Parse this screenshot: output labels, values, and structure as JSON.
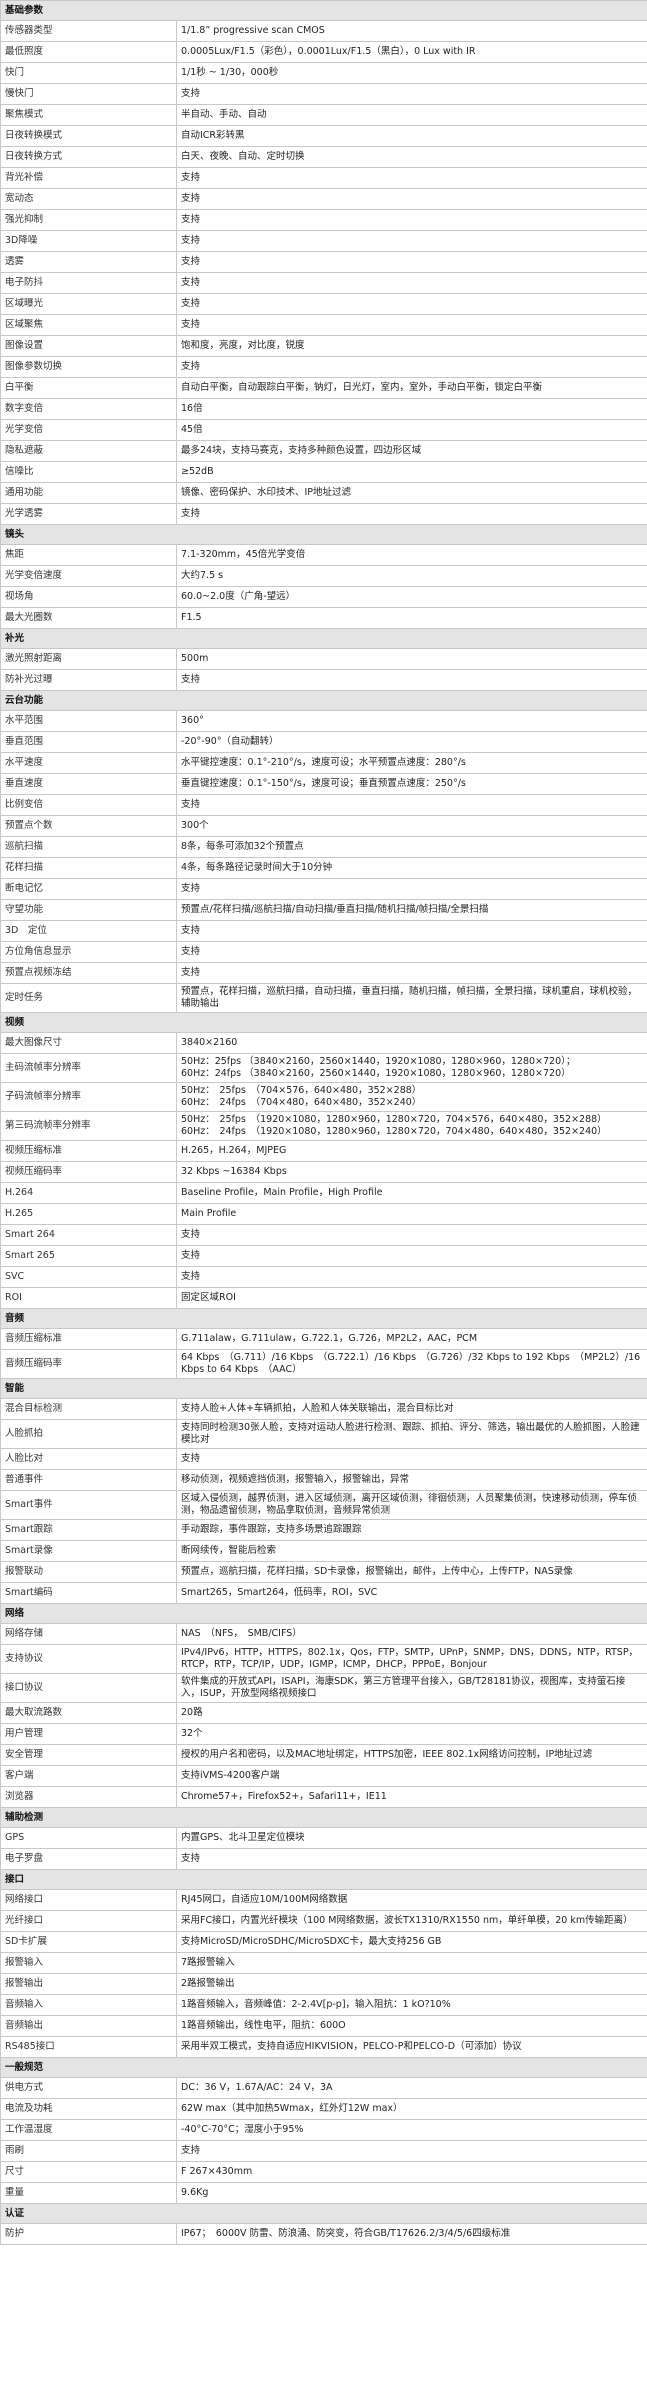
{
  "sections": [
    {
      "title": "基础参数",
      "rows": [
        [
          "传感器类型",
          "1/1.8” progressive scan CMOS"
        ],
        [
          "最低照度",
          "0.0005Lux/F1.5（彩色），0.0001Lux/F1.5（黑白），0 Lux with IR"
        ],
        [
          "快门",
          "1/1秒 ~ 1/30，000秒"
        ],
        [
          "慢快门",
          "支持"
        ],
        [
          "聚焦模式",
          "半自动、手动、自动"
        ],
        [
          "日夜转换模式",
          "自动ICR彩转黑"
        ],
        [
          "日夜转换方式",
          "白天、夜晚、自动、定时切换"
        ],
        [
          "背光补偿",
          "支持"
        ],
        [
          "宽动态",
          "支持"
        ],
        [
          "强光抑制",
          "支持"
        ],
        [
          "3D降噪",
          "支持"
        ],
        [
          "透雾",
          "支持"
        ],
        [
          "电子防抖",
          "支持"
        ],
        [
          "区域曝光",
          "支持"
        ],
        [
          "区域聚焦",
          "支持"
        ],
        [
          "图像设置",
          "饱和度，亮度，对比度，锐度"
        ],
        [
          "图像参数切换",
          "支持"
        ],
        [
          "白平衡",
          "自动白平衡，自动跟踪白平衡，钠灯，日光灯，室内，室外，手动白平衡，锁定白平衡"
        ],
        [
          "数字变倍",
          "16倍"
        ],
        [
          "光学变倍",
          "45倍"
        ],
        [
          "隐私遮蔽",
          "最多24块，支持马赛克，支持多种颜色设置，四边形区域"
        ],
        [
          "信噪比",
          "≥52dB"
        ],
        [
          "通用功能",
          "镜像、密码保护、水印技术、IP地址过滤"
        ],
        [
          "光学透雾",
          "支持"
        ]
      ]
    },
    {
      "title": "镜头",
      "rows": [
        [
          "焦距",
          "7.1-320mm，45倍光学变倍"
        ],
        [
          "光学变倍速度",
          "大约7.5 s"
        ],
        [
          "视场角",
          "60.0~2.0度（广角-望远）"
        ],
        [
          "最大光圈数",
          "F1.5"
        ]
      ]
    },
    {
      "title": "补光",
      "rows": [
        [
          "激光照射距离",
          "500m"
        ],
        [
          "防补光过曝",
          "支持"
        ]
      ]
    },
    {
      "title": "云台功能",
      "rows": [
        [
          "水平范围",
          "360°"
        ],
        [
          "垂直范围",
          "-20°-90°（自动翻转）"
        ],
        [
          "水平速度",
          "水平键控速度：0.1°-210°/s，速度可设；水平预置点速度：280°/s"
        ],
        [
          "垂直速度",
          "垂直键控速度：0.1°-150°/s，速度可设；垂直预置点速度：250°/s"
        ],
        [
          "比例变倍",
          "支持"
        ],
        [
          "预置点个数",
          "300个"
        ],
        [
          "巡航扫描",
          "8条，每条可添加32个预置点"
        ],
        [
          "花样扫描",
          "4条，每条路径记录时间大于10分钟"
        ],
        [
          "断电记忆",
          "支持"
        ],
        [
          "守望功能",
          "预置点/花样扫描/巡航扫描/自动扫描/垂直扫描/随机扫描/帧扫描/全景扫描"
        ],
        [
          "3D　定位",
          "支持"
        ],
        [
          "方位角信息显示",
          "支持"
        ],
        [
          "预置点视频冻结",
          "支持"
        ],
        [
          "定时任务",
          "预置点，花样扫描，巡航扫描，自动扫描，垂直扫描，随机扫描，帧扫描，全景扫描，球机重启，球机校验，辅助输出"
        ]
      ]
    },
    {
      "title": "视频",
      "rows": [
        [
          "最大图像尺寸",
          "3840×2160"
        ],
        [
          "主码流帧率分辨率",
          "50Hz：25fps （3840×2160，2560×1440，1920×1080，1280×960，1280×720）；\n60Hz：24fps （3840×2160，2560×1440，1920×1080，1280×960，1280×720）"
        ],
        [
          "子码流帧率分辨率",
          "50Hz：　25fps　（704×576，640×480，352×288）\n60Hz：　24fps　（704×480，640×480，352×240）"
        ],
        [
          "第三码流帧率分辨率",
          "50Hz：　25fps　（1920×1080，1280×960，1280×720，704×576，640×480，352×288）\n60Hz：　24fps　（1920×1080，1280×960，1280×720，704×480，640×480，352×240）"
        ],
        [
          "视频压缩标准",
          "H.265，H.264，MJPEG"
        ],
        [
          "视频压缩码率",
          "32 Kbps ~16384 Kbps"
        ],
        [
          "H.264",
          "Baseline Profile，Main Profile，High Profile"
        ],
        [
          "H.265",
          "Main Profile"
        ],
        [
          "Smart 264",
          "支持"
        ],
        [
          "Smart 265",
          "支持"
        ],
        [
          "SVC",
          "支持"
        ],
        [
          "ROI",
          "固定区域ROI"
        ]
      ]
    },
    {
      "title": "音频",
      "rows": [
        [
          "音频压缩标准",
          "G.711alaw，G.711ulaw，G.722.1，G.726，MP2L2，AAC，PCM"
        ],
        [
          "音频压缩码率",
          "64 Kbps　（G.711）/16 Kbps　（G.722.1）/16 Kbps　（G.726）/32 Kbps to 192 Kbps　（MP2L2）/16 Kbps to 64 Kbps　（AAC）"
        ]
      ]
    },
    {
      "title": "智能",
      "rows": [
        [
          "混合目标检测",
          "支持人脸+人体+车辆抓拍，人脸和人体关联输出，混合目标比对"
        ],
        [
          "人脸抓拍",
          "支持同时检测30张人脸，支持对运动人脸进行检测、跟踪、抓拍、评分、筛选，输出最优的人脸抓图，人脸建模比对"
        ],
        [
          "人脸比对",
          "支持"
        ],
        [
          "普通事件",
          "移动侦测，视频遮挡侦测，报警输入，报警输出，异常"
        ],
        [
          "Smart事件",
          "区域入侵侦测，越界侦测，进入区域侦测，离开区域侦测，徘徊侦测，人员聚集侦测，快速移动侦测，停车侦测，物品遗留侦测，物品拿取侦测，音频异常侦测"
        ],
        [
          "Smart跟踪",
          "手动跟踪，事件跟踪，支持多场景追踪跟踪"
        ],
        [
          "Smart录像",
          "断网续传，智能后检索"
        ],
        [
          "报警联动",
          "预置点，巡航扫描，花样扫描，SD卡录像，报警输出，邮件，上传中心，上传FTP，NAS录像"
        ],
        [
          "Smart编码",
          "Smart265，Smart264，低码率，ROI，SVC"
        ]
      ]
    },
    {
      "title": "网络",
      "rows": [
        [
          "网络存储",
          "NAS　（NFS，　SMB/CIFS）"
        ],
        [
          "支持协议",
          "IPv4/IPv6，HTTP，HTTPS，802.1x，Qos，FTP，SMTP，UPnP，SNMP，DNS，DDNS，NTP，RTSP，RTCP，RTP，TCP/IP，UDP，IGMP，ICMP，DHCP，PPPoE，Bonjour"
        ],
        [
          "接口协议",
          "软件集成的开放式API，ISAPI，海康SDK，第三方管理平台接入，GB/T28181协议，视图库，支持萤石接入，ISUP，开放型网络视频接口"
        ],
        [
          "最大取流路数",
          "20路"
        ],
        [
          "用户管理",
          "32个"
        ],
        [
          "安全管理",
          "授权的用户名和密码，以及MAC地址绑定，HTTPS加密，IEEE 802.1x网络访问控制，IP地址过滤"
        ],
        [
          "客户端",
          "支持iVMS-4200客户端"
        ],
        [
          "浏览器",
          "Chrome57+，Firefox52+，Safari11+，IE11"
        ]
      ]
    },
    {
      "title": "辅助检测",
      "rows": [
        [
          "GPS",
          "内置GPS、北斗卫星定位模块"
        ],
        [
          "电子罗盘",
          "支持"
        ]
      ]
    },
    {
      "title": "接口",
      "rows": [
        [
          "网络接口",
          "RJ45网口，自适应10M/100M网络数据"
        ],
        [
          "光纤接口",
          "采用FC接口，内置光纤模块（100 M网络数据，波长TX1310/RX1550 nm，单纤单模，20 km传输距离）"
        ],
        [
          "SD卡扩展",
          "支持MicroSD/MicroSDHC/MicroSDXC卡，最大支持256 GB"
        ],
        [
          "报警输入",
          "7路报警输入"
        ],
        [
          "报警输出",
          "2路报警输出"
        ],
        [
          "音频输入",
          "1路音频输入，音频峰值：2-2.4V[p-p]，输入阻抗：1 kO?10%"
        ],
        [
          "音频输出",
          "1路音频输出，线性电平，阻抗：600O"
        ],
        [
          "RS485接口",
          "采用半双工模式，支持自适应HIKVISION，PELCO-P和PELCO-D（可添加）协议"
        ]
      ]
    },
    {
      "title": "一般规范",
      "rows": [
        [
          "供电方式",
          "DC：36 V，1.67A/AC：24 V，3A"
        ],
        [
          "电流及功耗",
          "62W max（其中加热5Wmax，红外灯12W max）"
        ],
        [
          "工作温湿度",
          "-40°C-70°C；湿度小于95%"
        ],
        [
          "雨刷",
          "支持"
        ],
        [
          "尺寸",
          "F 267×430mm"
        ],
        [
          "重量",
          "9.6Kg"
        ]
      ]
    },
    {
      "title": "认证",
      "rows": [
        [
          "防护",
          "IP67；　6000V 防雷、防浪涌、防突变，符合GB/T17626.2/3/4/5/6四级标准"
        ]
      ]
    }
  ]
}
